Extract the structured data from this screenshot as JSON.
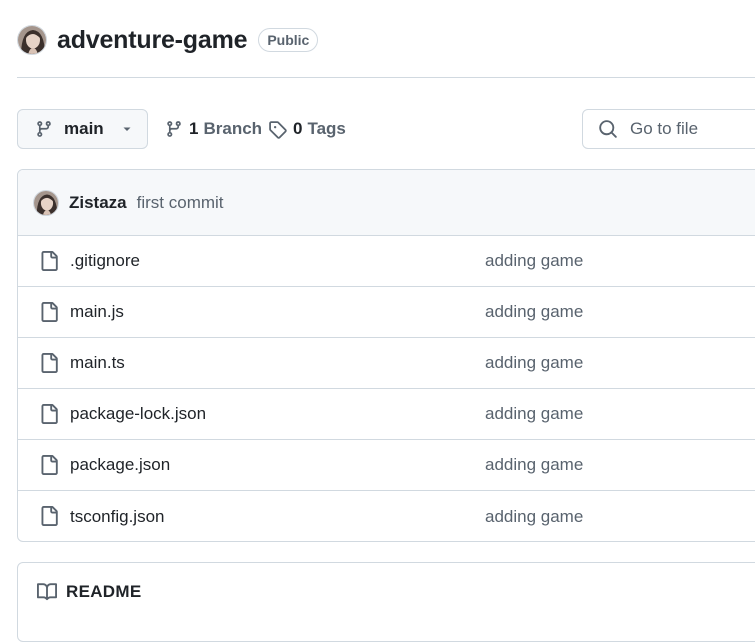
{
  "repo": {
    "name": "adventure-game",
    "visibility": "Public"
  },
  "toolbar": {
    "branch": "main",
    "branch_count": "1",
    "branch_word": "Branch",
    "tag_count": "0",
    "tag_word": "Tags",
    "goto_placeholder": "Go to file"
  },
  "commit": {
    "author": "Zistaza",
    "message": "first commit"
  },
  "files": [
    {
      "name": ".gitignore",
      "commit": "adding game"
    },
    {
      "name": "main.js",
      "commit": "adding game"
    },
    {
      "name": "main.ts",
      "commit": "adding game"
    },
    {
      "name": "package-lock.json",
      "commit": "adding game"
    },
    {
      "name": "package.json",
      "commit": "adding game"
    },
    {
      "name": "tsconfig.json",
      "commit": "adding game"
    }
  ],
  "readme": {
    "title": "README"
  },
  "icons": {
    "branch_button": "git-branch-icon",
    "branch_dropdown": "triangle-down-icon",
    "branches": "git-branch-icon",
    "tags": "tag-icon",
    "search": "search-icon",
    "file": "file-icon",
    "readme": "book-icon"
  }
}
